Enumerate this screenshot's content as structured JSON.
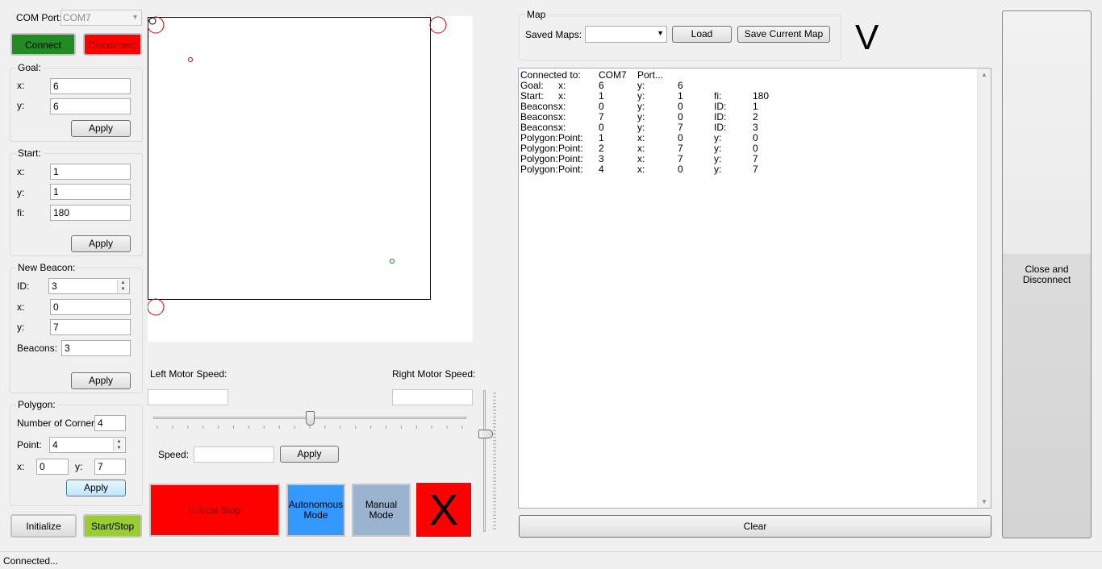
{
  "connection": {
    "com_port_label": "COM Port:",
    "com_port_value": "COM7",
    "connect_label": "Connect",
    "disconnect_label": "Disconnect"
  },
  "goal": {
    "title": "Goal:",
    "x_label": "x:",
    "x_value": "6",
    "y_label": "y:",
    "y_value": "6",
    "apply_label": "Apply"
  },
  "start": {
    "title": "Start:",
    "x_label": "x:",
    "x_value": "1",
    "y_label": "y:",
    "y_value": "1",
    "fi_label": "fi:",
    "fi_value": "180",
    "apply_label": "Apply"
  },
  "beacon": {
    "title": "New Beacon:",
    "id_label": "ID:",
    "id_value": "3",
    "x_label": "x:",
    "x_value": "0",
    "y_label": "y:",
    "y_value": "7",
    "beacons_label": "Beacons:",
    "beacons_value": "3",
    "apply_label": "Apply"
  },
  "polygon": {
    "title": "Polygon:",
    "corners_label": "Number of Corners:",
    "corners_value": "4",
    "point_label": "Point:",
    "point_value": "4",
    "x_label": "x:",
    "x_value": "0",
    "y_label": "y:",
    "y_value": "7",
    "apply_label": "Apply"
  },
  "bottom_left": {
    "initialize_label": "Initialize",
    "start_stop_label": "Start/Stop"
  },
  "motor": {
    "left_label": "Left Motor Speed:",
    "right_label": "Right Motor Speed:",
    "left_value": "",
    "right_value": "",
    "speed_label": "Speed:",
    "speed_value": "",
    "apply_label": "Apply",
    "horizontal_slider_level": 0.5,
    "vertical_slider_level": 0.7
  },
  "actions": {
    "critical_stop_label": "Critical Stop",
    "autonomous_label": "Autonomous\nMode",
    "manual_label": "Manual\nMode",
    "x_label": "X"
  },
  "map": {
    "title": "Map",
    "saved_maps_label": "Saved Maps:",
    "saved_maps_value": "",
    "load_label": "Load",
    "save_label": "Save Current Map"
  },
  "indicator": {
    "v_label": "V"
  },
  "log": {
    "rows": [
      [
        "Connected to:",
        "",
        "COM7",
        "Port...",
        "",
        "",
        ""
      ],
      [
        "Goal:",
        "x:",
        "6",
        "y:",
        "6",
        "",
        ""
      ],
      [
        "Start:",
        "x:",
        "1",
        "y:",
        "1",
        "fi:",
        "180"
      ],
      [
        "Beacons:",
        "x:",
        "0",
        "y:",
        "0",
        "ID:",
        "1"
      ],
      [
        "Beacons:",
        "x:",
        "7",
        "y:",
        "0",
        "ID:",
        "2"
      ],
      [
        "Beacons:",
        "x:",
        "0",
        "y:",
        "7",
        "ID:",
        "3"
      ],
      [
        "Polygon:",
        "Point:",
        "1",
        "x:",
        "0",
        "y:",
        "0"
      ],
      [
        "Polygon:",
        "Point:",
        "2",
        "x:",
        "7",
        "y:",
        "0"
      ],
      [
        "Polygon:",
        "Point:",
        "3",
        "x:",
        "7",
        "y:",
        "7"
      ],
      [
        "Polygon:",
        "Point:",
        "4",
        "x:",
        "0",
        "y:",
        "7"
      ]
    ],
    "clear_label": "Clear"
  },
  "close_disconnect_label": "Close and\nDisconnect",
  "status_text": "Connected...",
  "colors": {
    "connect": "#228b22",
    "disconnect": "#ff0000",
    "start_stop": "#9acd32",
    "critical": "#ff0000",
    "autonomous": "#3399ff",
    "manual": "#9ab4d0",
    "x_button": "#ff0000"
  }
}
